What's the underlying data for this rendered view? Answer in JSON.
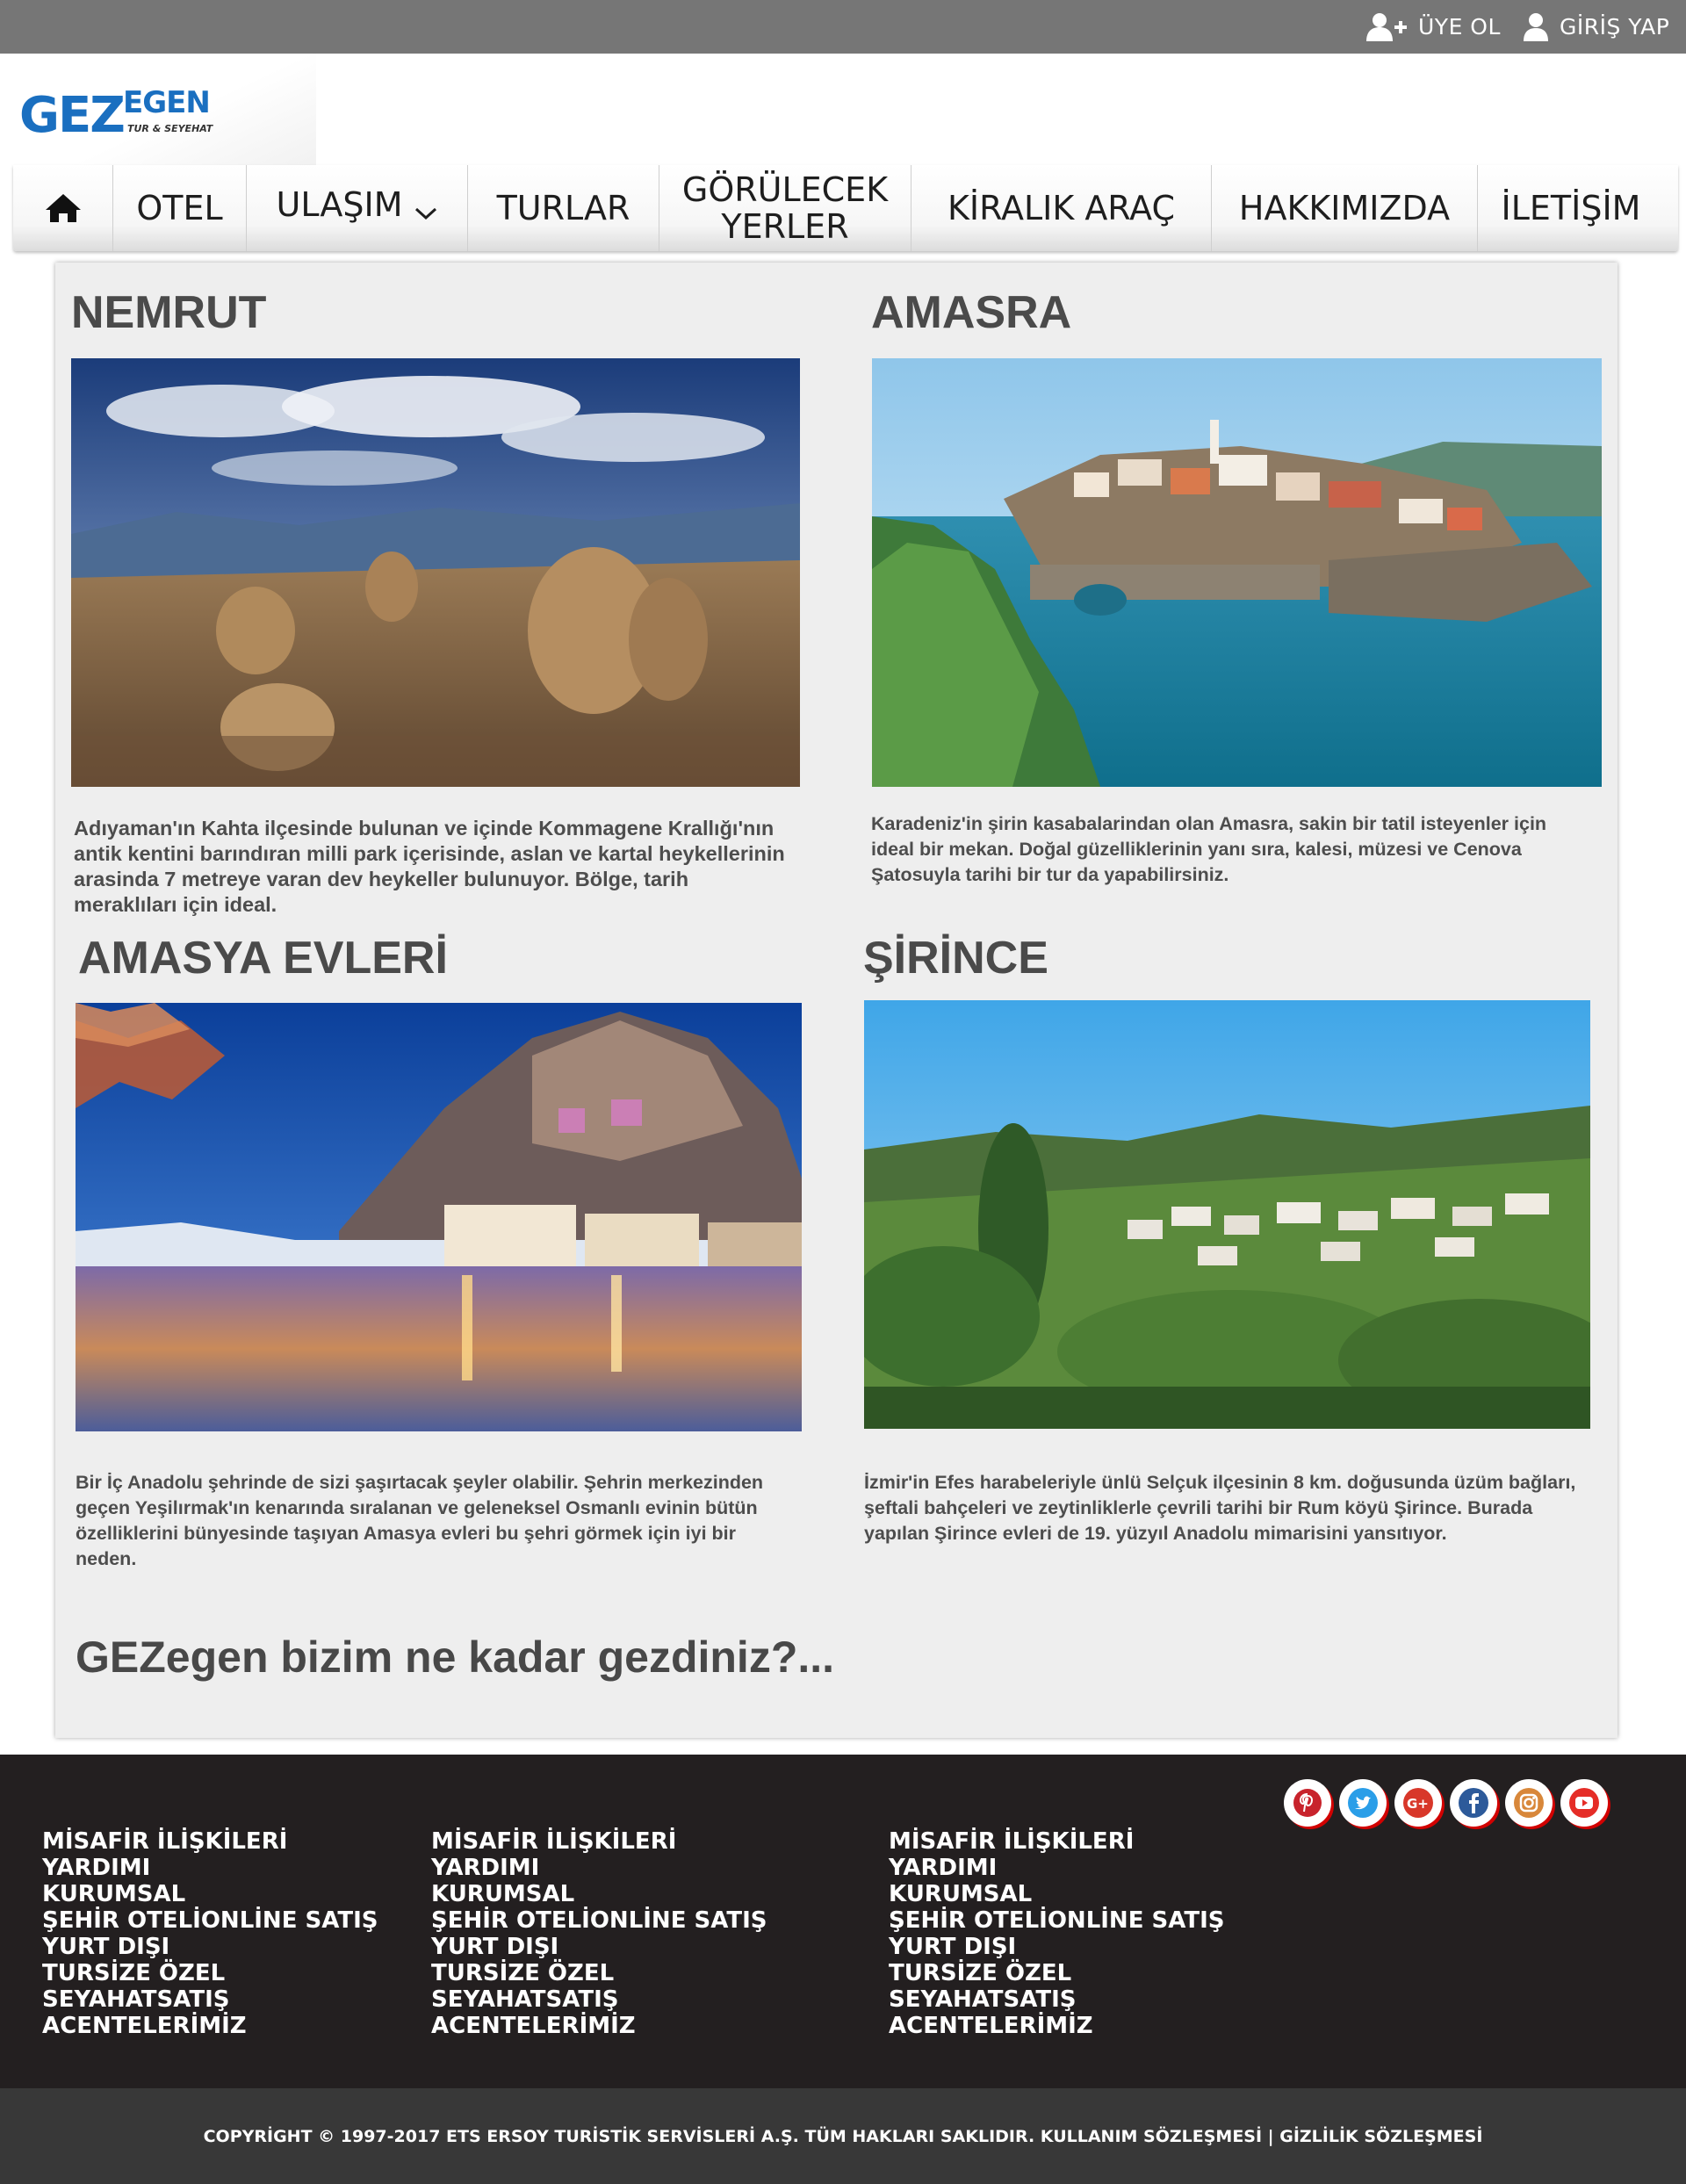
{
  "topbar": {
    "register_label": "ÜYE OL",
    "login_label": "GİRİŞ YAP"
  },
  "logo": {
    "main": "GEZ",
    "accent": "EGEN",
    "tagline": "TUR & SEYEHAT"
  },
  "nav": {
    "otel": "OTEL",
    "ulasim": "ULAŞIM",
    "turlar": "TURLAR",
    "gorulecek_line1": "GÖRÜLECEK",
    "gorulecek_line2": "YERLER",
    "kiralik": "KİRALIK ARAÇ",
    "hakkimizda": "HAKKIMIZDA",
    "iletisim": "İLETİŞİM"
  },
  "destinations": [
    {
      "title": "NEMRUT",
      "text": "Adıyaman'ın Kahta ilçesinde bulunan ve içinde Kommagene Krallığı'nın antik kentini barındıran milli park içerisinde, aslan ve kartal heykellerinin arasinda 7 metreye varan dev heykeller bulunuyor. Bölge, tarih meraklıları için ideal."
    },
    {
      "title": "AMASRA",
      "text": "Karadeniz'in şirin kasabalarindan olan Amasra, sakin bir tatil isteyenler için ideal bir mekan. Doğal güzelliklerinin yanı sıra, kalesi, müzesi ve Cenova Şatosuyla tarihi bir tur da yapabilirsiniz."
    },
    {
      "title": "AMASYA EVLERİ",
      "text": "Bir İç Anadolu şehrinde de sizi şaşırtacak şeyler olabilir. Şehrin merkezinden geçen Yeşilırmak'ın kenarında sıralanan ve geleneksel Osmanlı evinin bütün özelliklerini bünyesinde taşıyan Amasya evleri bu şehri görmek için iyi bir neden."
    },
    {
      "title": "ŞİRİNCE",
      "text": "İzmir'in Efes harabeleriyle ünlü Selçuk ilçesinin 8 km. doğusunda üzüm bağları, şeftali bahçeleri ve zeytinliklerle çevrili tarihi bir Rum köyü Şirince. Burada yapılan Şirince evleri de 19. yüzyıl Anadolu mimarisini yansıtıyor."
    }
  ],
  "question": "GEZegen bizim ne kadar gezdiniz?...",
  "footer": {
    "columns": [
      [
        "MİSAFİR İLİŞKİLERİ",
        "YARDIMI",
        "KURUMSAL",
        "ŞEHİR OTELİONLİNE SATIŞ",
        "YURT DIŞI",
        "TURSİZE ÖZEL",
        "SEYAHATSATIŞ",
        "ACENTELERİMİZ"
      ],
      [
        "MİSAFİR İLİŞKİLERİ",
        "YARDIMI",
        "KURUMSAL",
        "ŞEHİR OTELİONLİNE SATIŞ",
        "YURT DIŞI",
        "TURSİZE ÖZEL",
        "SEYAHATSATIŞ",
        "ACENTELERİMİZ"
      ],
      [
        "MİSAFİR İLİŞKİLERİ",
        "YARDIMI",
        "KURUMSAL",
        "ŞEHİR OTELİONLİNE SATIŞ",
        "YURT DIŞI",
        "TURSİZE ÖZEL",
        "SEYAHATSATIŞ",
        "ACENTELERİMİZ"
      ]
    ],
    "social": [
      "pinterest-icon",
      "twitter-icon",
      "google-plus-icon",
      "facebook-icon",
      "instagram-icon",
      "youtube-icon"
    ],
    "copyright": "COPYRİGHT © 1997-2017 ETS ERSOY TURİSTİK SERVİSLERİ A.Ş. TÜM HAKLARI SAKLIDIR. KULLANIM SÖZLEŞMESİ | GİZLİLİK SÖZLEŞMESİ"
  },
  "colors": {
    "topbar": "#767676",
    "brand": "#1a6fc0",
    "content_bg": "#eeeeee",
    "footer_bg": "#231f20",
    "copyright_bg": "#383838",
    "social_accent": "#dc0000"
  }
}
